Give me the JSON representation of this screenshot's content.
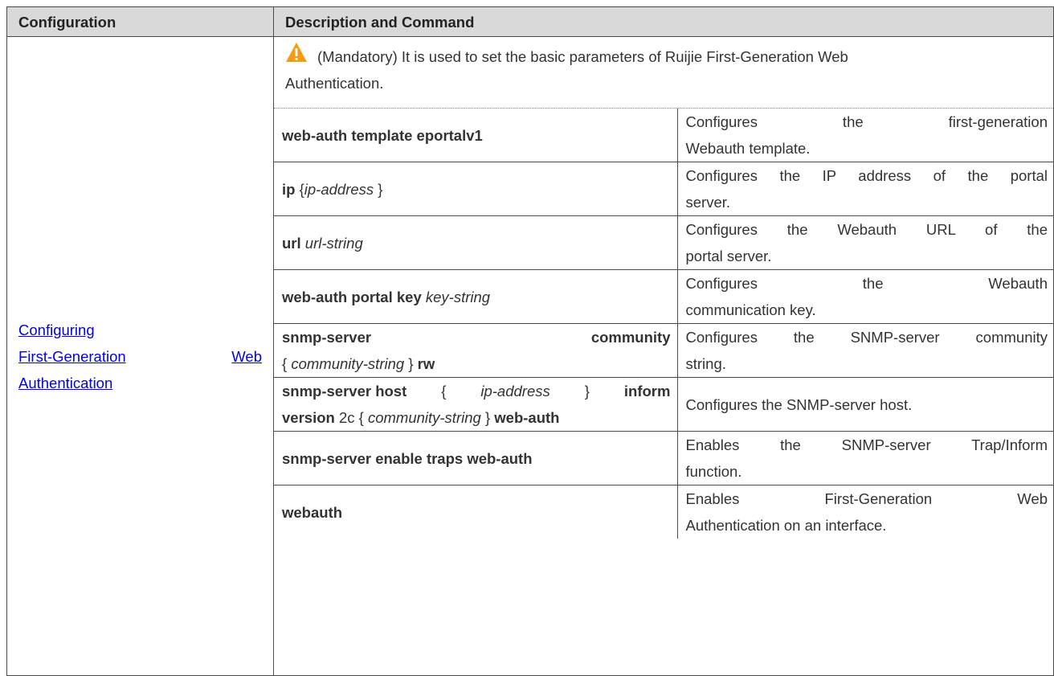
{
  "header": {
    "col1": "Configuration",
    "col2": "Description and Command"
  },
  "config_link": {
    "line1": "Configuring",
    "line2_a": "First-Generation",
    "line2_b": "Web",
    "line3": "Authentication"
  },
  "note": {
    "icon": "warning-triangle-icon",
    "icon_color": "#f39c12",
    "line1": "(Mandatory) It is used to set the basic parameters of Ruijie First-Generation Web",
    "line2": "Authentication."
  },
  "rows": [
    {
      "cmd": "web-auth template eportalv1",
      "desc1": "Configures the first-generation",
      "desc2": "Webauth template."
    },
    {
      "cmd_bold": "ip",
      "cmd_rest_open": " {",
      "cmd_arg": "ip-address",
      "cmd_rest_close": " }",
      "desc1": "Configures the IP address of the portal",
      "desc2": "server."
    },
    {
      "cmd_bold": "url",
      "cmd_arg": "url-string",
      "desc1": "Configures the Webauth URL of the",
      "desc2": "portal server."
    },
    {
      "cmd_bold": "web-auth portal key",
      "cmd_arg": "key-string",
      "desc1": "Configures the Webauth",
      "desc2": "communication key."
    },
    {
      "cmd_line1_a": "snmp-server",
      "cmd_line1_b": "community",
      "cmd_line2_open": "{",
      "cmd_line2_arg": "community-string",
      "cmd_line2_close": "}",
      "cmd_line2_bold": "rw",
      "desc1": "Configures the SNMP-server community",
      "desc2": "string."
    },
    {
      "l1_bold1": "snmp-server host",
      "l1_open": "{",
      "l1_arg": "ip-address",
      "l1_close": "}",
      "l1_bold2": "inform",
      "l2_bold1": "version",
      "l2_plain": "2c {",
      "l2_arg": "community-string",
      "l2_close": "}",
      "l2_bold2": "web-auth",
      "desc": "Configures the SNMP-server host."
    },
    {
      "cmd": "snmp-server enable traps web-auth",
      "desc1": "Enables the SNMP-server Trap/Inform",
      "desc2": "function."
    },
    {
      "cmd": "webauth",
      "desc1": "Enables First-Generation Web",
      "desc2": "Authentication on an interface."
    }
  ]
}
